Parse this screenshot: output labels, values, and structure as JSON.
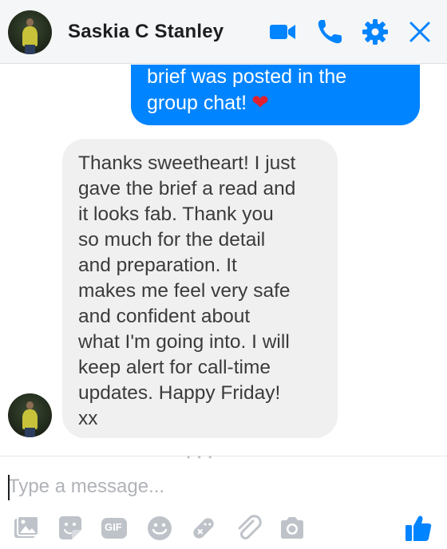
{
  "header": {
    "contact_name": "Saskia C Stanley",
    "icons": [
      "video-camera-icon",
      "phone-icon",
      "gear-icon",
      "close-icon"
    ]
  },
  "messages": {
    "outgoing_text": "brief was posted in the\ngroup chat!",
    "outgoing_emoji": "❤",
    "incoming_text": "Thanks sweetheart! I just\ngave the brief a read and\nit looks fab. Thank you\nso much for the  detail\nand preparation. It\nmakes me feel very safe\nand confident about\nwhat I'm going into. I will\nkeep alert for call-time\nupdates. Happy Friday!\nxx"
  },
  "composer": {
    "placeholder": "Type a message...",
    "gif_label": "GIF",
    "toolbar_icons": [
      "photo-icon",
      "sticker-icon",
      "gif-icon",
      "emoji-icon",
      "game-icon",
      "attachment-icon",
      "camera-icon",
      "like-thumb-icon"
    ]
  },
  "colors": {
    "accent": "#0084ff",
    "outgoing_bubble": "#0084ff",
    "incoming_bubble": "#f1f0f0",
    "header_bg": "#f5f6f7",
    "toolbar_icon": "#bec3c9",
    "heart": "#e0202e"
  }
}
